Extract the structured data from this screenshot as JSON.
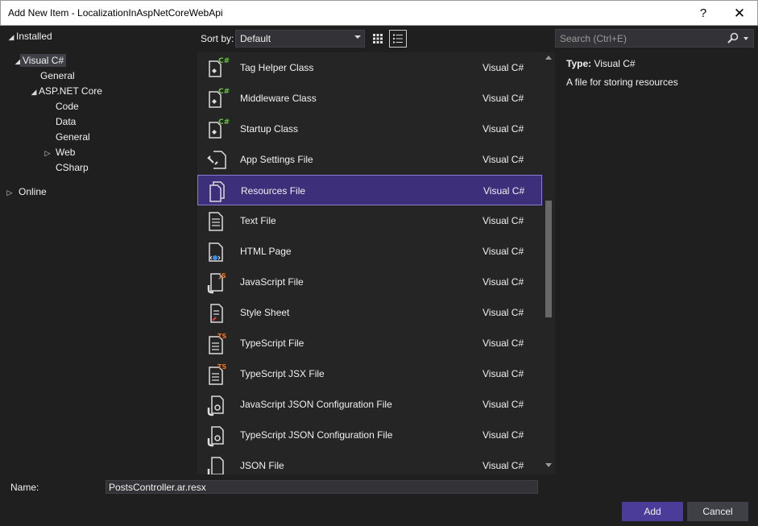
{
  "window": {
    "title": "Add New Item - LocalizationInAspNetCoreWebApi",
    "help_glyph": "?",
    "close_glyph": "✕"
  },
  "tree": {
    "installed": "Installed",
    "visual_csharp": "Visual C#",
    "general": "General",
    "aspnet_core": "ASP.NET Core",
    "code": "Code",
    "data": "Data",
    "general_sub": "General",
    "web": "Web",
    "csharp": "CSharp",
    "online": "Online"
  },
  "toolbar": {
    "sort_label": "Sort by:",
    "sort_value": "Default",
    "search_placeholder": "Search (Ctrl+E)"
  },
  "items": [
    {
      "name": "Tag Helper Class",
      "lang": "Visual C#",
      "icon": "csharp-class-icon"
    },
    {
      "name": "Middleware Class",
      "lang": "Visual C#",
      "icon": "csharp-class-icon"
    },
    {
      "name": "Startup Class",
      "lang": "Visual C#",
      "icon": "csharp-class-icon"
    },
    {
      "name": "App Settings File",
      "lang": "Visual C#",
      "icon": "settings-file-icon"
    },
    {
      "name": "Resources File",
      "lang": "Visual C#",
      "icon": "resources-file-icon"
    },
    {
      "name": "Text File",
      "lang": "Visual C#",
      "icon": "text-file-icon"
    },
    {
      "name": "HTML Page",
      "lang": "Visual C#",
      "icon": "html-file-icon"
    },
    {
      "name": "JavaScript File",
      "lang": "Visual C#",
      "icon": "javascript-file-icon"
    },
    {
      "name": "Style Sheet",
      "lang": "Visual C#",
      "icon": "stylesheet-icon"
    },
    {
      "name": "TypeScript File",
      "lang": "Visual C#",
      "icon": "typescript-file-icon"
    },
    {
      "name": "TypeScript JSX File",
      "lang": "Visual C#",
      "icon": "typescript-jsx-icon"
    },
    {
      "name": "JavaScript JSON Configuration File",
      "lang": "Visual C#",
      "icon": "json-config-icon"
    },
    {
      "name": "TypeScript JSON Configuration File",
      "lang": "Visual C#",
      "icon": "json-config-icon"
    },
    {
      "name": "JSON File",
      "lang": "Visual C#",
      "icon": "json-file-icon"
    }
  ],
  "details": {
    "type_label": "Type:",
    "type_value": "Visual C#",
    "description": "A file for storing resources"
  },
  "footer": {
    "name_label": "Name:",
    "name_value": "PostsController.ar.resx",
    "add_label": "Add",
    "cancel_label": "Cancel"
  },
  "colors": {
    "accent": "#4b3c9a",
    "selection": "#3e2f7a",
    "background": "#1f1f1f"
  }
}
